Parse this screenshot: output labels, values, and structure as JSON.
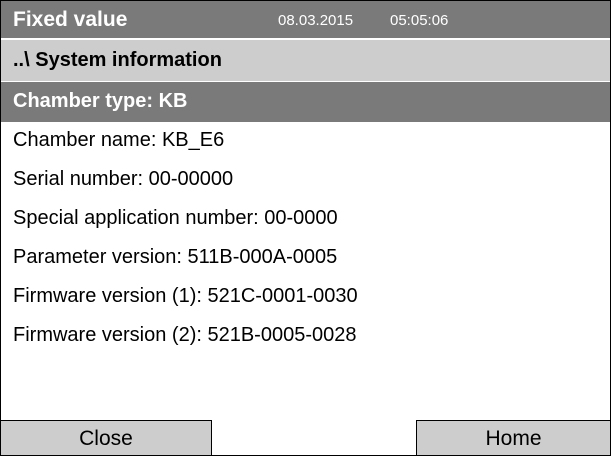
{
  "header": {
    "mode": "Fixed value",
    "date": "08.03.2015",
    "time": "05:05:06"
  },
  "path": "..\\ System information",
  "selected_item": "Chamber type: KB",
  "info_items": [
    "Chamber name: KB_E6",
    "Serial number: 00-00000",
    "Special application number: 00-0000",
    "Parameter version: 511B-000A-0005",
    "Firmware version (1): 521C-0001-0030",
    "Firmware version (2): 521B-0005-0028"
  ],
  "buttons": {
    "close_label": "Close",
    "home_label": "Home"
  },
  "colors": {
    "header_bg": "#7a7a7a",
    "path_bg": "#cdcdcd",
    "selected_bg": "#7a7a7a",
    "button_bg": "#cdcdcd"
  }
}
